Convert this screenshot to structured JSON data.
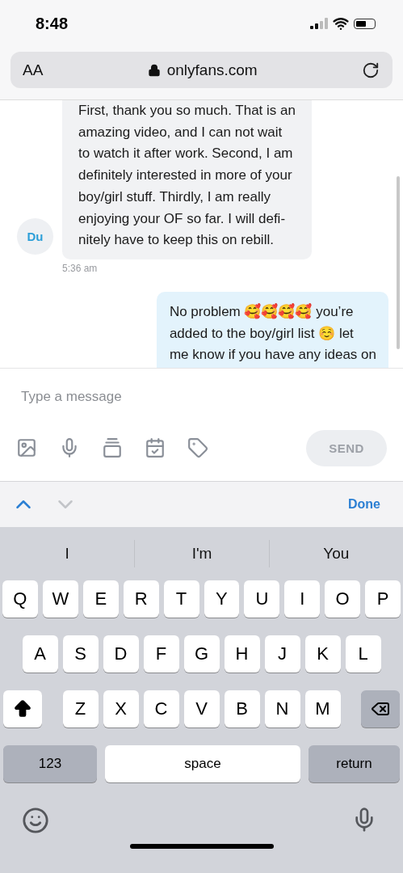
{
  "status_bar": {
    "time": "8:48"
  },
  "address_bar": {
    "text_size": "AA",
    "url": "onlyfans.com"
  },
  "messages": [
    {
      "kind": "received",
      "avatar": "Du",
      "text": "First, thank you so much. That is an\namazing video, and I can not wait\nto watch it after work. Second, I am\ndefinitely interested in more of your\nboy/girl stuff. Thirdly, I am really\nenjoying your OF so far. I will defi-\nnitely have to keep this on rebill.",
      "time": "5:36 am"
    },
    {
      "kind": "sent",
      "text": "No problem 🥰🥰🥰🥰 you’re\nadded to the boy/girl list ☺️ let\nme know if you have any ideas on"
    }
  ],
  "composer": {
    "placeholder": "Type a message",
    "send": {
      "label": "SEND",
      "disabled": true
    }
  },
  "accessory": {
    "done": "Done"
  },
  "suggestions": [
    "I",
    "I'm",
    "You"
  ],
  "keyboard": {
    "rows": [
      [
        "Q",
        "W",
        "E",
        "R",
        "T",
        "Y",
        "U",
        "I",
        "O",
        "P"
      ],
      [
        "A",
        "S",
        "D",
        "F",
        "G",
        "H",
        "J",
        "K",
        "L"
      ],
      [
        "Z",
        "X",
        "C",
        "V",
        "B",
        "N",
        "M"
      ]
    ],
    "number_key": "123",
    "space": "space",
    "return": "return"
  }
}
